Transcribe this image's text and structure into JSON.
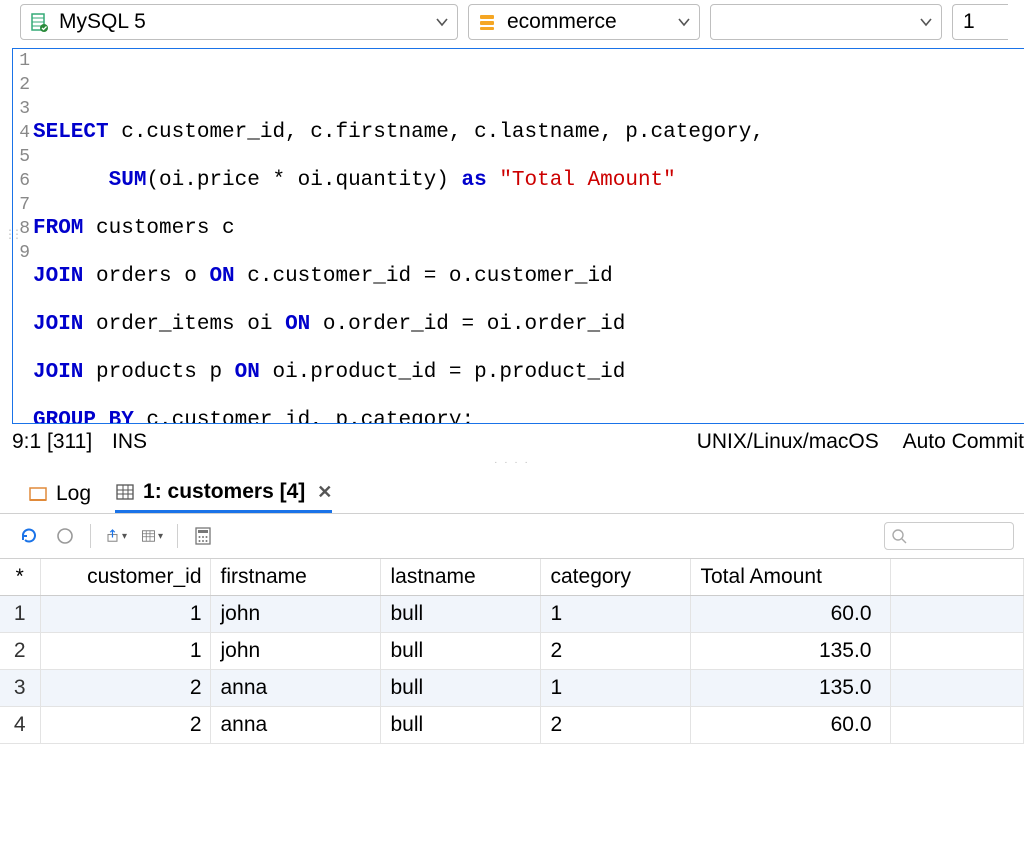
{
  "toolbar": {
    "db_engine": "MySQL 5",
    "schema": "ecommerce",
    "empty_select": "",
    "num_box": "1"
  },
  "editor": {
    "lines": [
      "1",
      "2",
      "3",
      "4",
      "5",
      "6",
      "7",
      "8",
      "9"
    ],
    "sql": {
      "l2a": "SELECT",
      "l2b": " c.customer_id, c.firstname, c.lastname, p.category,",
      "l3a": "      ",
      "l3b": "SUM",
      "l3c": "(oi.price * oi.quantity) ",
      "l3d": "as",
      "l3e": " ",
      "l3f": "\"Total Amount\"",
      "l4a": "FROM",
      "l4b": " customers c",
      "l5a": "JOIN",
      "l5b": " orders o ",
      "l5c": "ON",
      "l5d": " c.customer_id = o.customer_id",
      "l6a": "JOIN",
      "l6b": " order_items oi ",
      "l6c": "ON",
      "l6d": " o.order_id = oi.order_id",
      "l7a": "JOIN",
      "l7b": " products p ",
      "l7c": "ON",
      "l7d": " oi.product_id = p.product_id",
      "l8a": "GROUP BY",
      "l8b": " c.customer_id, p.category;"
    }
  },
  "status": {
    "pos": "9:1 [311]",
    "mode": "INS",
    "eol": "UNIX/Linux/macOS",
    "commit": "Auto Commit"
  },
  "tabs": {
    "log": "Log",
    "result_label": "1: customers [4]"
  },
  "grid": {
    "star": "*",
    "columns": [
      "customer_id",
      "firstname",
      "lastname",
      "category",
      "Total Amount"
    ],
    "rows": [
      {
        "n": "1",
        "customer_id": "1",
        "firstname": "john",
        "lastname": "bull",
        "category": "1",
        "amount": "60.0"
      },
      {
        "n": "2",
        "customer_id": "1",
        "firstname": "john",
        "lastname": "bull",
        "category": "2",
        "amount": "135.0"
      },
      {
        "n": "3",
        "customer_id": "2",
        "firstname": "anna",
        "lastname": "bull",
        "category": "1",
        "amount": "135.0"
      },
      {
        "n": "4",
        "customer_id": "2",
        "firstname": "anna",
        "lastname": "bull",
        "category": "2",
        "amount": "60.0"
      }
    ]
  }
}
